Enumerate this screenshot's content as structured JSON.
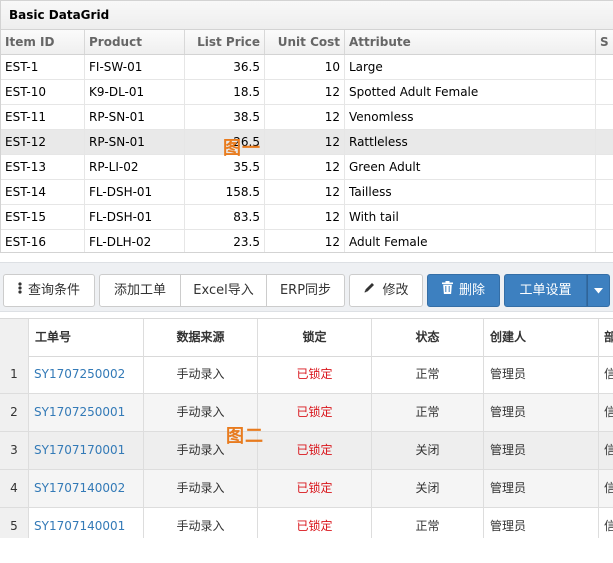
{
  "grid1": {
    "title": "Basic DataGrid",
    "columns": [
      "Item ID",
      "Product",
      "List Price",
      "Unit Cost",
      "Attribute",
      "S"
    ],
    "rows": [
      {
        "id": "EST-1",
        "product": "FI-SW-01",
        "list_price": "36.5",
        "unit_cost": "10",
        "attribute": "Large"
      },
      {
        "id": "EST-10",
        "product": "K9-DL-01",
        "list_price": "18.5",
        "unit_cost": "12",
        "attribute": "Spotted Adult Female"
      },
      {
        "id": "EST-11",
        "product": "RP-SN-01",
        "list_price": "38.5",
        "unit_cost": "12",
        "attribute": "Venomless"
      },
      {
        "id": "EST-12",
        "product": "RP-SN-01",
        "list_price": "26.5",
        "unit_cost": "12",
        "attribute": "Rattleless"
      },
      {
        "id": "EST-13",
        "product": "RP-LI-02",
        "list_price": "35.5",
        "unit_cost": "12",
        "attribute": "Green Adult"
      },
      {
        "id": "EST-14",
        "product": "FL-DSH-01",
        "list_price": "158.5",
        "unit_cost": "12",
        "attribute": "Tailless"
      },
      {
        "id": "EST-15",
        "product": "FL-DSH-01",
        "list_price": "83.5",
        "unit_cost": "12",
        "attribute": "With tail"
      },
      {
        "id": "EST-16",
        "product": "FL-DLH-02",
        "list_price": "23.5",
        "unit_cost": "12",
        "attribute": "Adult Female"
      }
    ],
    "annotation": "图一"
  },
  "toolbar": {
    "query_label": "查询条件",
    "add_label": "添加工单",
    "excel_label": "Excel导入",
    "erp_label": "ERP同步",
    "edit_label": "修改",
    "delete_label": "删除",
    "settings_label": "工单设置"
  },
  "grid2": {
    "columns": [
      "工单号",
      "数据来源",
      "锁定",
      "状态",
      "创建人",
      "部"
    ],
    "rows": [
      {
        "num": "1",
        "order_no": "SY1707250002",
        "source": "手动录入",
        "lock": "已锁定",
        "status": "正常",
        "creator": "管理员",
        "more": "信"
      },
      {
        "num": "2",
        "order_no": "SY1707250001",
        "source": "手动录入",
        "lock": "已锁定",
        "status": "正常",
        "creator": "管理员",
        "more": "信"
      },
      {
        "num": "3",
        "order_no": "SY1707170001",
        "source": "手动录入",
        "lock": "已锁定",
        "status": "关闭",
        "creator": "管理员",
        "more": "信"
      },
      {
        "num": "4",
        "order_no": "SY1707140002",
        "source": "手动录入",
        "lock": "已锁定",
        "status": "关闭",
        "creator": "管理员",
        "more": "信"
      },
      {
        "num": "5",
        "order_no": "SY1707140001",
        "source": "手动录入",
        "lock": "已锁定",
        "status": "正常",
        "creator": "管理员",
        "more": "信"
      }
    ],
    "annotation": "图二"
  },
  "colors": {
    "primary": "#3d80c0",
    "link": "#337ab7",
    "locked": "#d9161c",
    "annotation": "#e87b1e"
  }
}
